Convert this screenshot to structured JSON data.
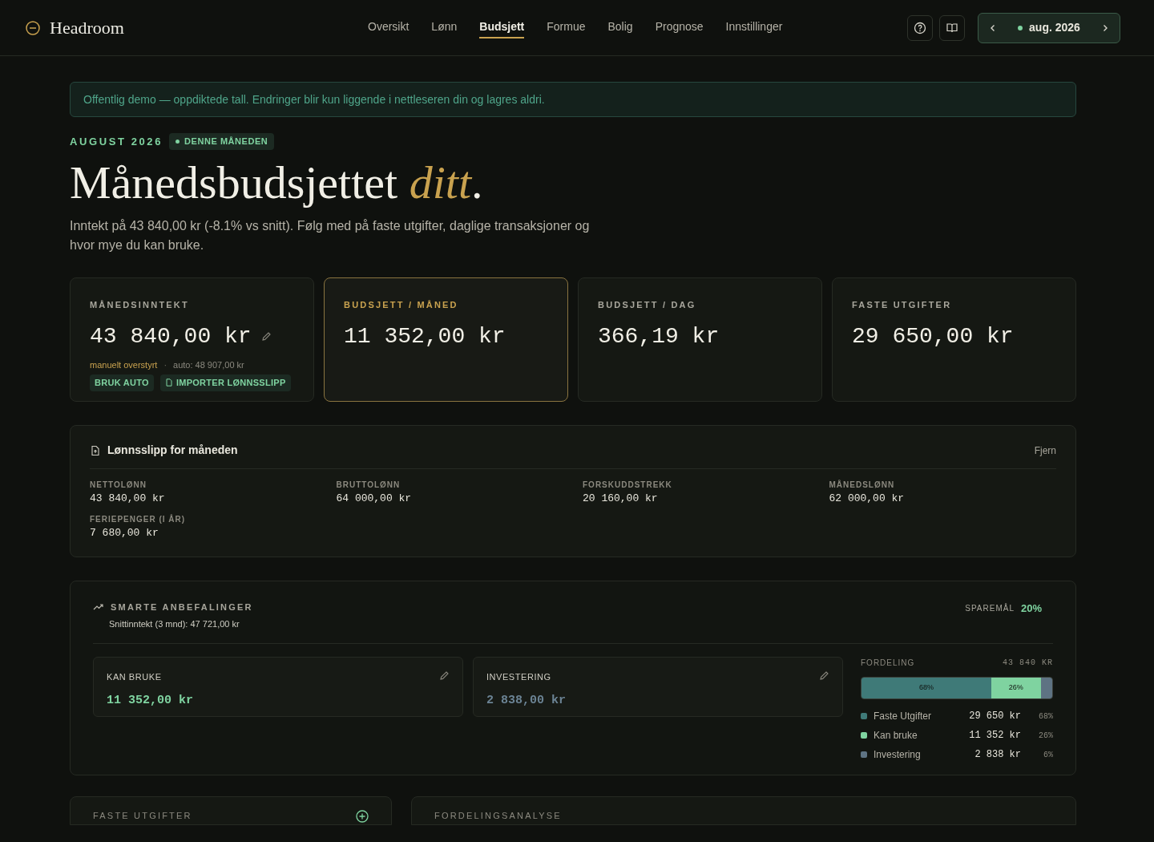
{
  "brand": {
    "name": "Headroom"
  },
  "nav": [
    {
      "label": "Oversikt",
      "selected": false
    },
    {
      "label": "Lønn",
      "selected": false
    },
    {
      "label": "Budsjett",
      "selected": true
    },
    {
      "label": "Formue",
      "selected": false
    },
    {
      "label": "Bolig",
      "selected": false
    },
    {
      "label": "Prognose",
      "selected": false
    },
    {
      "label": "Innstillinger",
      "selected": false
    }
  ],
  "month_picker": {
    "label": "aug. 2026"
  },
  "notice": "Offentlig demo — oppdiktede tall. Endringer blir kun liggende i nettleseren din og lagres aldri.",
  "heading": {
    "eyebrow": "AUGUST 2026",
    "badge": "DENNE MÅNEDEN",
    "title": "Månedsbudsjettet *ditt*.",
    "subtitle": "Inntekt på 43 840,00 kr (-8.1% vs snitt). Følg med på faste utgifter, daglige transaksjoner og hvor mye du kan bruke."
  },
  "stats": [
    {
      "label": "MÅNEDSINNTEKT",
      "value": "43 840,00 kr",
      "highlighted": false,
      "editable": true,
      "note": "manuelt overstyrt",
      "separator": "·",
      "auto": "auto: 48 907,00 kr",
      "actions": [
        "BRUK AUTO",
        "IMPORTER LØNNSSLIPP"
      ]
    },
    {
      "label": "BUDSJETT / MÅNED",
      "value": "11 352,00 kr",
      "highlighted": true,
      "editable": false
    },
    {
      "label": "BUDSJETT / DAG",
      "value": "366,19 kr",
      "highlighted": false,
      "editable": false
    },
    {
      "label": "FASTE UTGIFTER",
      "value": "29 650,00 kr",
      "highlighted": false,
      "editable": false
    }
  ],
  "payslip": {
    "title": "Lønnsslipp for måneden",
    "remove": "Fjern",
    "fields": [
      {
        "label": "NETTOLØNN",
        "value": "43 840,00 kr"
      },
      {
        "label": "BRUTTOLØNN",
        "value": "64 000,00 kr"
      },
      {
        "label": "FORSKUDDSTREKK",
        "value": "20 160,00 kr"
      },
      {
        "label": "MÅNEDSLØNN",
        "value": "62 000,00 kr"
      },
      {
        "label": "FERIEPENGER (I ÅR)",
        "value": "7 680,00 kr"
      }
    ]
  },
  "recommendations": {
    "title": "SMARTE ANBEFALINGER",
    "subtitle": "Snittinntekt (3 mnd): 47 721,00 kr",
    "goal_label": "SPAREMÅL",
    "goal_value": "20%",
    "cards": [
      {
        "label": "KAN BRUKE",
        "value": "11 352,00 kr",
        "color": "#7fd3a0"
      },
      {
        "label": "INVESTERING",
        "value": "2 838,00 kr",
        "color": "#6b8394"
      }
    ],
    "distribution": {
      "title": "FORDELING",
      "total": "43 840 KR",
      "items": [
        {
          "name": "Faste Utgifter",
          "amount": "29 650 kr",
          "percent": "68%",
          "color": "#3f7a78",
          "bar_label": "68%"
        },
        {
          "name": "Kan bruke",
          "amount": "11 352 kr",
          "percent": "26%",
          "color": "#7fd3a0",
          "bar_label": "26%"
        },
        {
          "name": "Investering",
          "amount": "2 838 kr",
          "percent": "6%",
          "color": "#5e7383"
        }
      ]
    }
  },
  "bottom_panels": [
    {
      "title": "FASTE UTGIFTER",
      "add_button": true
    },
    {
      "title": "FORDELINGSANALYSE",
      "add_button": false
    }
  ]
}
